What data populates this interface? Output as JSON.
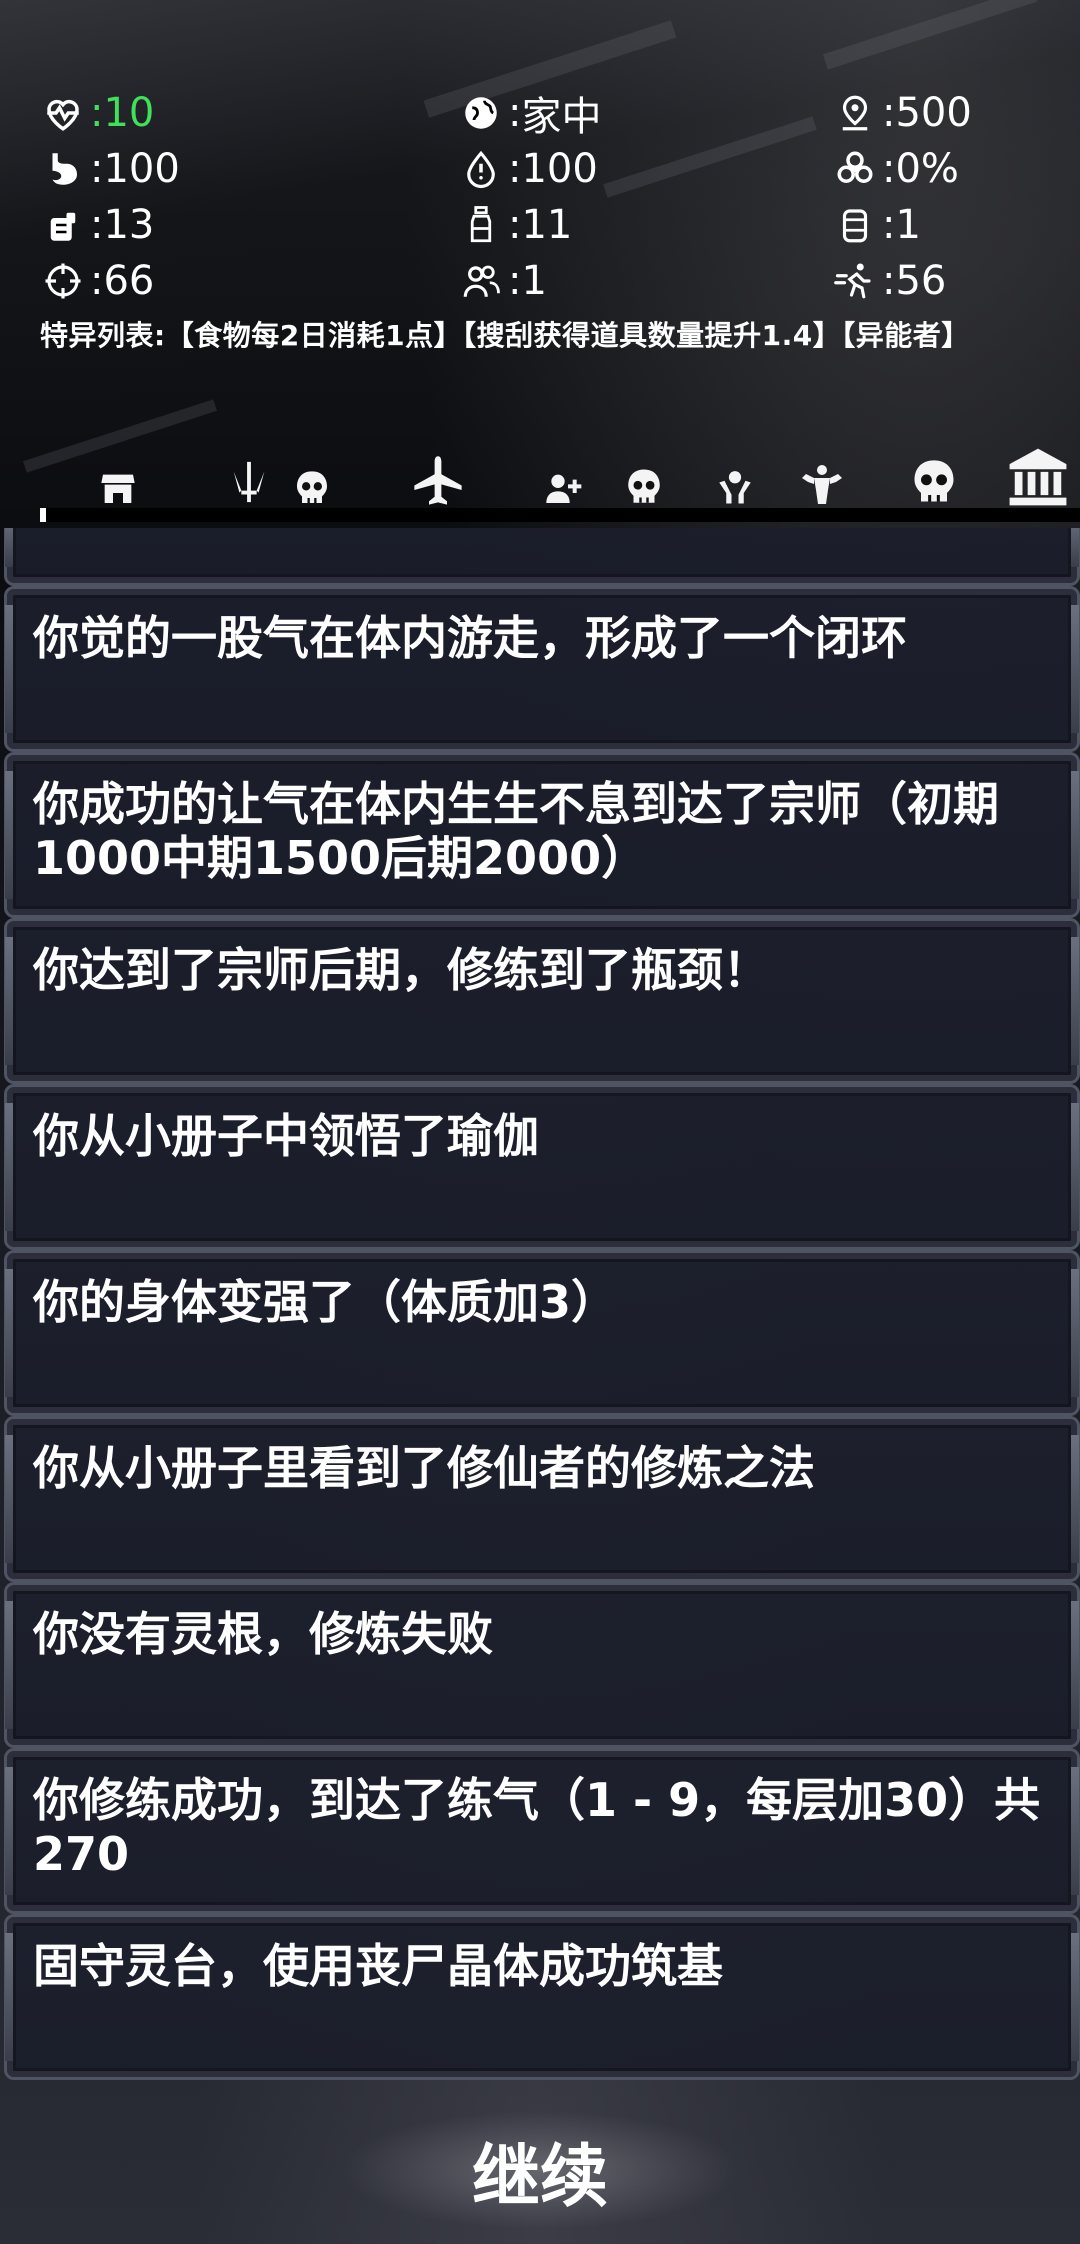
{
  "stats": {
    "health": "10",
    "location": "家中",
    "distance": "500",
    "hunger": "100",
    "water": "100",
    "infection": "0%",
    "food": "13",
    "drink": "11",
    "supplies": "1",
    "aim": "66",
    "companions": "1",
    "speed": "56"
  },
  "traits": "特异列表:【食物每2日消耗1点】【搜刮获得道具数量提升1.4】【异能者】",
  "tabs": [
    {
      "name": "shop",
      "icon": "store-icon"
    },
    {
      "name": "weapons",
      "icon": "swords-icon"
    },
    {
      "name": "zombies-1",
      "icon": "skull-icon"
    },
    {
      "name": "travel",
      "icon": "airplane-icon"
    },
    {
      "name": "recruit",
      "icon": "add-user-icon"
    },
    {
      "name": "zombies-2",
      "icon": "skull-icon"
    },
    {
      "name": "ability",
      "icon": "hands-icon"
    },
    {
      "name": "strength",
      "icon": "muscle-icon"
    },
    {
      "name": "zombies-3",
      "icon": "skull-icon"
    },
    {
      "name": "bank",
      "icon": "bank-icon"
    }
  ],
  "log": [
    "你觉的一股气在体内游走，形成了一个闭环",
    "你成功的让气在体内生生不息到达了宗师（初期1000中期1500后期2000）",
    "你达到了宗师后期，修练到了瓶颈！",
    "你从小册子中领悟了瑜伽",
    "你的身体变强了（体质加3）",
    "你从小册子里看到了修仙者的修炼之法",
    "你没有灵根，修炼失败",
    "你修练成功，到达了练气（1 - 9，每层加30）共270",
    "固守灵台，使用丧尸晶体成功筑基"
  ],
  "continue_label": "继续",
  "colors": {
    "health_value": "#3fe05a",
    "card_bg": "#1c1f2c",
    "card_border": "#4e5462"
  }
}
